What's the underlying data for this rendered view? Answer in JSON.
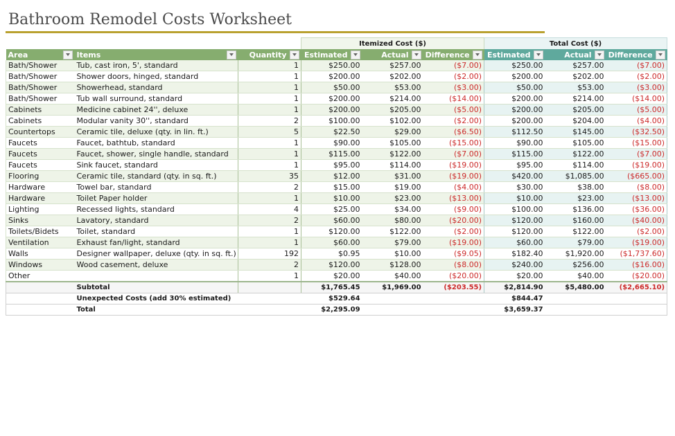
{
  "title": "Bathroom Remodel Costs Worksheet",
  "groups": {
    "itemized": "Itemized Cost ($)",
    "total": "Total Cost ($)"
  },
  "headers": [
    "Area",
    "Items",
    "Quantity",
    "Estimated",
    "Actual",
    "Difference",
    "Estimated",
    "Actual",
    "Difference"
  ],
  "colors": {
    "green_header": "#86ad6f",
    "teal_header": "#5fa99d",
    "negative": "#cc2a2a",
    "title_rule": "#b9a12f"
  },
  "rows": [
    {
      "area": "Bath/Shower",
      "item": "Tub, cast iron, 5', standard",
      "qty": "1",
      "ie": "$250.00",
      "ia": "$257.00",
      "id": "($7.00)",
      "te": "$250.00",
      "ta": "$257.00",
      "td": "($7.00)"
    },
    {
      "area": "Bath/Shower",
      "item": "Shower doors, hinged, standard",
      "qty": "1",
      "ie": "$200.00",
      "ia": "$202.00",
      "id": "($2.00)",
      "te": "$200.00",
      "ta": "$202.00",
      "td": "($2.00)"
    },
    {
      "area": "Bath/Shower",
      "item": "Showerhead, standard",
      "qty": "1",
      "ie": "$50.00",
      "ia": "$53.00",
      "id": "($3.00)",
      "te": "$50.00",
      "ta": "$53.00",
      "td": "($3.00)"
    },
    {
      "area": "Bath/Shower",
      "item": "Tub wall surround, standard",
      "qty": "1",
      "ie": "$200.00",
      "ia": "$214.00",
      "id": "($14.00)",
      "te": "$200.00",
      "ta": "$214.00",
      "td": "($14.00)"
    },
    {
      "area": "Cabinets",
      "item": "Medicine cabinet 24'', deluxe",
      "qty": "1",
      "ie": "$200.00",
      "ia": "$205.00",
      "id": "($5.00)",
      "te": "$200.00",
      "ta": "$205.00",
      "td": "($5.00)"
    },
    {
      "area": "Cabinets",
      "item": "Modular vanity 30'', standard",
      "qty": "2",
      "ie": "$100.00",
      "ia": "$102.00",
      "id": "($2.00)",
      "te": "$200.00",
      "ta": "$204.00",
      "td": "($4.00)"
    },
    {
      "area": "Countertops",
      "item": "Ceramic tile, deluxe (qty. in lin. ft.)",
      "qty": "5",
      "ie": "$22.50",
      "ia": "$29.00",
      "id": "($6.50)",
      "te": "$112.50",
      "ta": "$145.00",
      "td": "($32.50)"
    },
    {
      "area": "Faucets",
      "item": "Faucet, bathtub, standard",
      "qty": "1",
      "ie": "$90.00",
      "ia": "$105.00",
      "id": "($15.00)",
      "te": "$90.00",
      "ta": "$105.00",
      "td": "($15.00)"
    },
    {
      "area": "Faucets",
      "item": "Faucet, shower, single handle, standard",
      "qty": "1",
      "ie": "$115.00",
      "ia": "$122.00",
      "id": "($7.00)",
      "te": "$115.00",
      "ta": "$122.00",
      "td": "($7.00)"
    },
    {
      "area": "Faucets",
      "item": "Sink faucet, standard",
      "qty": "1",
      "ie": "$95.00",
      "ia": "$114.00",
      "id": "($19.00)",
      "te": "$95.00",
      "ta": "$114.00",
      "td": "($19.00)"
    },
    {
      "area": "Flooring",
      "item": "Ceramic tile, standard (qty. in sq. ft.)",
      "qty": "35",
      "ie": "$12.00",
      "ia": "$31.00",
      "id": "($19.00)",
      "te": "$420.00",
      "ta": "$1,085.00",
      "td": "($665.00)"
    },
    {
      "area": "Hardware",
      "item": "Towel bar, standard",
      "qty": "2",
      "ie": "$15.00",
      "ia": "$19.00",
      "id": "($4.00)",
      "te": "$30.00",
      "ta": "$38.00",
      "td": "($8.00)"
    },
    {
      "area": "Hardware",
      "item": "Toilet Paper holder",
      "qty": "1",
      "ie": "$10.00",
      "ia": "$23.00",
      "id": "($13.00)",
      "te": "$10.00",
      "ta": "$23.00",
      "td": "($13.00)"
    },
    {
      "area": "Lighting",
      "item": "Recessed lights, standard",
      "qty": "4",
      "ie": "$25.00",
      "ia": "$34.00",
      "id": "($9.00)",
      "te": "$100.00",
      "ta": "$136.00",
      "td": "($36.00)"
    },
    {
      "area": "Sinks",
      "item": "Lavatory, standard",
      "qty": "2",
      "ie": "$60.00",
      "ia": "$80.00",
      "id": "($20.00)",
      "te": "$120.00",
      "ta": "$160.00",
      "td": "($40.00)"
    },
    {
      "area": "Toilets/Bidets",
      "item": "Toilet, standard",
      "qty": "1",
      "ie": "$120.00",
      "ia": "$122.00",
      "id": "($2.00)",
      "te": "$120.00",
      "ta": "$122.00",
      "td": "($2.00)"
    },
    {
      "area": "Ventilation",
      "item": "Exhaust fan/light, standard",
      "qty": "1",
      "ie": "$60.00",
      "ia": "$79.00",
      "id": "($19.00)",
      "te": "$60.00",
      "ta": "$79.00",
      "td": "($19.00)"
    },
    {
      "area": "Walls",
      "item": "Designer wallpaper, deluxe (qty. in sq. ft.)",
      "qty": "192",
      "ie": "$0.95",
      "ia": "$10.00",
      "id": "($9.05)",
      "te": "$182.40",
      "ta": "$1,920.00",
      "td": "($1,737.60)"
    },
    {
      "area": "Windows",
      "item": "Wood casement, deluxe",
      "qty": "2",
      "ie": "$120.00",
      "ia": "$128.00",
      "id": "($8.00)",
      "te": "$240.00",
      "ta": "$256.00",
      "td": "($16.00)"
    },
    {
      "area": "Other",
      "item": "",
      "qty": "1",
      "ie": "$20.00",
      "ia": "$40.00",
      "id": "($20.00)",
      "te": "$20.00",
      "ta": "$40.00",
      "td": "($20.00)"
    }
  ],
  "subtotal": {
    "label": "Subtotal",
    "ie": "$1,765.45",
    "ia": "$1,969.00",
    "id": "($203.55)",
    "te": "$2,814.90",
    "ta": "$5,480.00",
    "td": "($2,665.10)"
  },
  "unexpected": {
    "label": "Unexpected Costs (add 30% estimated)",
    "ie": "$529.64",
    "te": "$844.47"
  },
  "total": {
    "label": "Total",
    "ie": "$2,295.09",
    "te": "$3,659.37"
  }
}
